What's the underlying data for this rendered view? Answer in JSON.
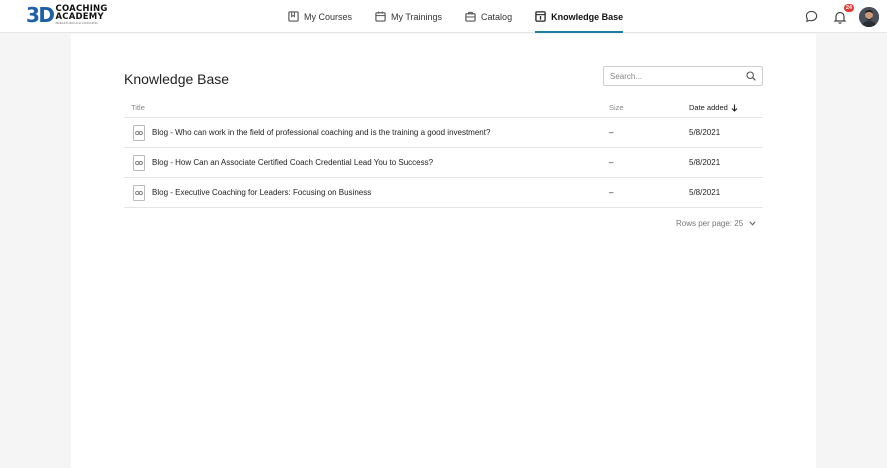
{
  "logo": {
    "mark": "3D",
    "line1": "COACHING",
    "line2": "ACADEMY",
    "line3": "BREAKTHROUGH COACHING"
  },
  "nav": [
    {
      "label": "My Courses",
      "icon": "courses-icon"
    },
    {
      "label": "My Trainings",
      "icon": "calendar-icon"
    },
    {
      "label": "Catalog",
      "icon": "catalog-icon"
    },
    {
      "label": "Knowledge Base",
      "icon": "knowledge-base-icon",
      "active": true
    }
  ],
  "header": {
    "notification_count": "24"
  },
  "page": {
    "title": "Knowledge Base"
  },
  "search": {
    "placeholder": "Search..."
  },
  "table": {
    "columns": {
      "title": "Title",
      "size": "Size",
      "date": "Date added"
    },
    "rows": [
      {
        "title": "Blog - Who can work in the field of professional coaching and is the training a good investment?",
        "size": "–",
        "date": "5/8/2021"
      },
      {
        "title": "Blog - How Can an Associate Certified Coach Credential Lead You to Success?",
        "size": "–",
        "date": "5/8/2021"
      },
      {
        "title": "Blog - Executive Coaching for Leaders: Focusing on Business",
        "size": "–",
        "date": "5/8/2021"
      }
    ]
  },
  "pagination": {
    "rows_per_page": "Rows per page: 25"
  },
  "colors": {
    "accent": "#1a7f9e",
    "badge": "#e53935",
    "logo_blue": "#1e5fa8"
  }
}
